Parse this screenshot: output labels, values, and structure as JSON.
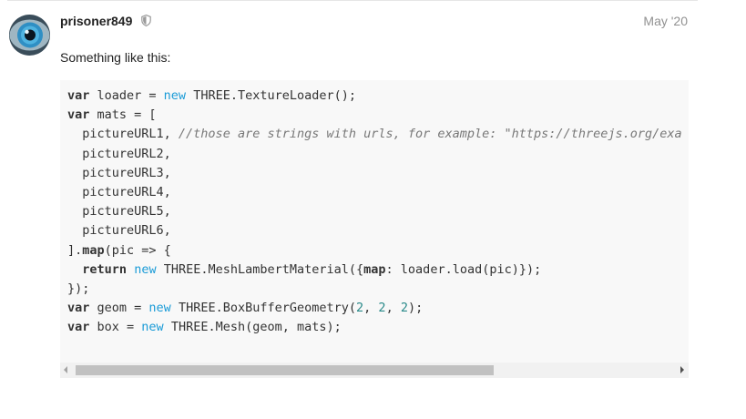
{
  "post": {
    "username": "prisoner849",
    "date": "May '20",
    "text": "Something like this:"
  },
  "icons": {
    "avatar": "eye-avatar",
    "badge": "shield-icon",
    "scroll_left": "triangle-left-icon",
    "scroll_right": "triangle-right-icon"
  },
  "colors": {
    "keyword_new": "#1a9bd7",
    "number": "#2a8a8a",
    "comment": "#777777",
    "date": "#919191"
  },
  "code": {
    "lines": [
      [
        [
          "kw",
          "var"
        ],
        [
          "t",
          " loader = "
        ],
        [
          "new",
          "new"
        ],
        [
          "t",
          " THREE.TextureLoader();"
        ]
      ],
      [
        [
          "kw",
          "var"
        ],
        [
          "t",
          " mats = ["
        ]
      ],
      [
        [
          "t",
          "  pictureURL1, "
        ],
        [
          "cmt",
          "//those are strings with urls, for example: \"https://threejs.org/exa"
        ]
      ],
      [
        [
          "t",
          "  pictureURL2,"
        ]
      ],
      [
        [
          "t",
          "  pictureURL3,"
        ]
      ],
      [
        [
          "t",
          "  pictureURL4,"
        ]
      ],
      [
        [
          "t",
          "  pictureURL5,"
        ]
      ],
      [
        [
          "t",
          "  pictureURL6,"
        ]
      ],
      [
        [
          "t",
          "]."
        ],
        [
          "kw",
          "map"
        ],
        [
          "t",
          "(pic => {"
        ]
      ],
      [
        [
          "t",
          "  "
        ],
        [
          "kw",
          "return"
        ],
        [
          "t",
          " "
        ],
        [
          "new",
          "new"
        ],
        [
          "t",
          " THREE.MeshLambertMaterial({"
        ],
        [
          "kw",
          "map"
        ],
        [
          "t",
          ": loader.load(pic)});"
        ]
      ],
      [
        [
          "t",
          "});"
        ]
      ],
      [
        [
          "kw",
          "var"
        ],
        [
          "t",
          " geom = "
        ],
        [
          "new",
          "new"
        ],
        [
          "t",
          " THREE.BoxBufferGeometry("
        ],
        [
          "num",
          "2"
        ],
        [
          "t",
          ", "
        ],
        [
          "num",
          "2"
        ],
        [
          "t",
          ", "
        ],
        [
          "num",
          "2"
        ],
        [
          "t",
          ");"
        ]
      ],
      [
        [
          "kw",
          "var"
        ],
        [
          "t",
          " box = "
        ],
        [
          "new",
          "new"
        ],
        [
          "t",
          " THREE.Mesh(geom, mats);"
        ]
      ]
    ]
  },
  "scrollbar": {
    "position_fraction": 0.0,
    "visible_fraction": 0.7
  }
}
